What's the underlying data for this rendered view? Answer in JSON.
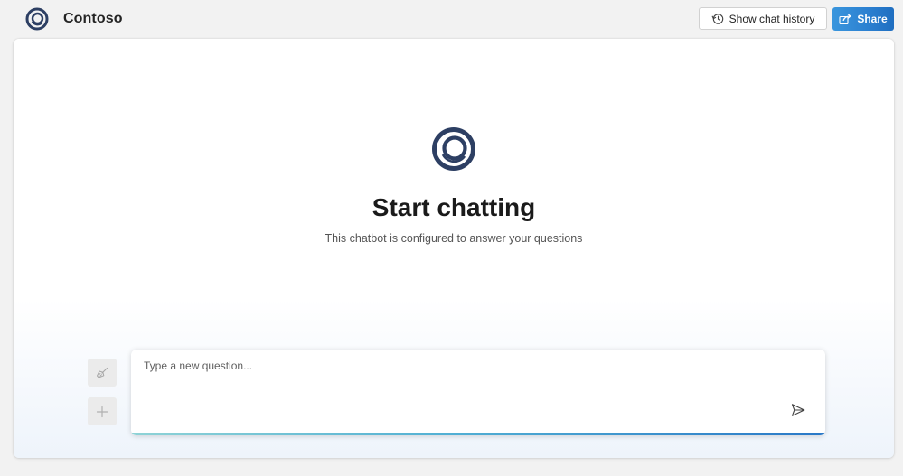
{
  "header": {
    "brand": "Contoso",
    "history_button": "Show chat history",
    "share_button": "Share"
  },
  "hero": {
    "title": "Start chatting",
    "subtitle": "This chatbot is configured to answer your questions"
  },
  "composer": {
    "placeholder": "Type a new question...",
    "value": ""
  },
  "icons": {
    "logo": "contoso-ring-logo",
    "history": "history-clock-icon",
    "share": "share-arrow-icon",
    "clear": "broom-icon",
    "add": "plus-icon",
    "send": "send-icon"
  },
  "colors": {
    "brand_navy": "#2d3f63",
    "share_blue": "#2b7fd0",
    "accent_teal": "#8fd3d6",
    "accent_blue": "#2a78c7"
  }
}
